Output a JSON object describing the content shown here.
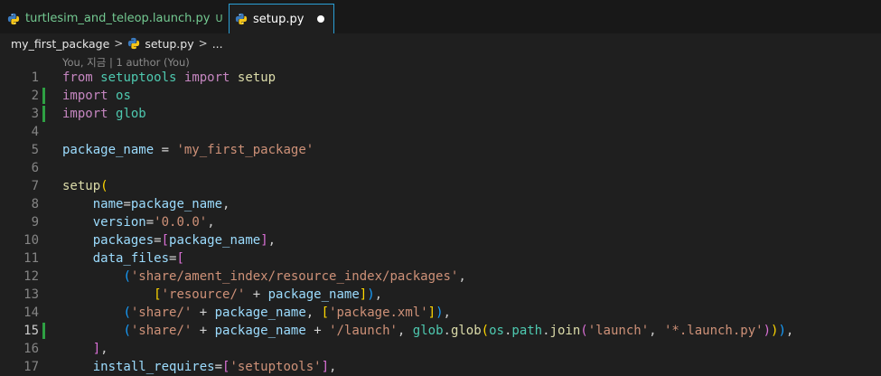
{
  "tabs": [
    {
      "label": "turtlesim_and_teleop.launch.py",
      "status": "U",
      "active": false
    },
    {
      "label": "setup.py",
      "modified": true,
      "active": true
    }
  ],
  "breadcrumb": {
    "folder": "my_first_package",
    "file": "setup.py",
    "more": "..."
  },
  "editor": {
    "blame": "You, 지금 | 1 author (You)",
    "line_numbers": [
      "1",
      "2",
      "3",
      "4",
      "5",
      "6",
      "7",
      "8",
      "9",
      "10",
      "11",
      "12",
      "13",
      "14",
      "15",
      "16",
      "17"
    ]
  },
  "code": {
    "l1": {
      "kw1": "from",
      "mod": "setuptools",
      "kw2": "import",
      "name": "setup"
    },
    "l2": {
      "kw": "import",
      "name": "os"
    },
    "l3": {
      "kw": "import",
      "name": "glob"
    },
    "l5": {
      "var": "package_name",
      "op": " = ",
      "str": "'my_first_package'"
    },
    "l7": {
      "fn": "setup",
      "par": "("
    },
    "l8": {
      "key": "name",
      "eq": "=",
      "val": "package_name",
      "comma": ","
    },
    "l9": {
      "key": "version",
      "eq": "=",
      "str": "'0.0.0'",
      "comma": ","
    },
    "l10": {
      "key": "packages",
      "eq": "=",
      "lb": "[",
      "val": "package_name",
      "rb": "]",
      "comma": ","
    },
    "l11": {
      "key": "data_files",
      "eq": "=",
      "lb": "["
    },
    "l12": {
      "lp": "(",
      "str": "'share/ament_index/resource_index/packages'",
      "comma": ","
    },
    "l13": {
      "lb": "[",
      "str": "'resource/'",
      "op": " + ",
      "val": "package_name",
      "rb": "]",
      "rp": ")",
      "comma": ","
    },
    "l14": {
      "lp": "(",
      "str1": "'share/'",
      "op": " + ",
      "val": "package_name",
      "comma1": ", ",
      "lb": "[",
      "str2": "'package.xml'",
      "rb": "]",
      "rp": ")",
      "comma2": ","
    },
    "l15": {
      "lp": "(",
      "str1": "'share/'",
      "op1": " + ",
      "val": "package_name",
      "op2": " + ",
      "str2": "'/launch'",
      "comma1": ", ",
      "mod": "glob",
      "dot1": ".",
      "fn1": "glob",
      "lp2": "(",
      "mod2": "os",
      "dot2": ".",
      "attr": "path",
      "dot3": ".",
      "fn2": "join",
      "lp3": "(",
      "str3": "'launch'",
      "comma2": ", ",
      "str4": "'*.launch.py'",
      "rp3": ")",
      "rp2": ")",
      "rp1": ")",
      "comma3": ","
    },
    "l16": {
      "rb": "]",
      "comma": ","
    },
    "l17": {
      "key": "install_requires",
      "eq": "=",
      "lb": "[",
      "str": "'setuptools'",
      "rb": "]",
      "comma": ","
    }
  },
  "colors": {
    "keyword": "#c586c0",
    "module": "#4ec9b0",
    "function": "#dcdcaa",
    "string": "#ce9178",
    "variable": "#9cdcfe",
    "untracked": "#73c991",
    "git_added": "#2ea043",
    "active_tab_border": "#2a9fd6"
  },
  "icons": {
    "tab_file": "python-icon",
    "modified": "unsaved-dot-icon",
    "breadcrumb_separator": "chevron-right-icon"
  }
}
